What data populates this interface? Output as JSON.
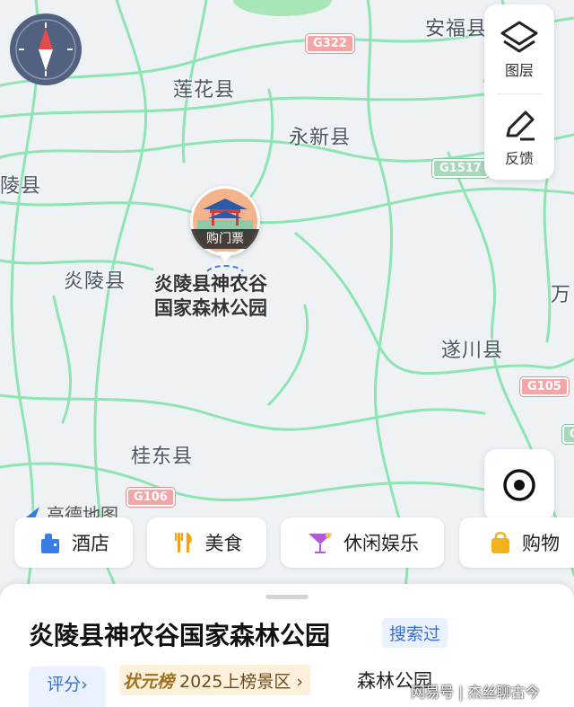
{
  "map": {
    "places": [
      {
        "name": "安福县"
      },
      {
        "name": "莲花县"
      },
      {
        "name": "永新县"
      },
      {
        "name": "陵县"
      },
      {
        "name": "炎陵县"
      },
      {
        "name": "遂川县"
      },
      {
        "name": "桂东县"
      },
      {
        "name": "万"
      }
    ],
    "roads": [
      "G322",
      "G1517",
      "G105",
      "G106",
      "G"
    ],
    "poi": {
      "ticket_label": "购门票",
      "name_line1": "炎陵县神农谷",
      "name_line2": "国家森林公园"
    },
    "watermark": "高德地图",
    "colors": {
      "road": "#7ee0a6",
      "bg": "#eef2f5",
      "compass": "#526180"
    }
  },
  "side_panel": {
    "layers_label": "图层",
    "feedback_label": "反馈",
    "layers_icon": "layers-icon",
    "feedback_icon": "pen-icon"
  },
  "categories": [
    {
      "label": "酒店",
      "icon": "hotel-icon"
    },
    {
      "label": "美食",
      "icon": "food-icon"
    },
    {
      "label": "休闲娱乐",
      "icon": "cocktail-icon"
    },
    {
      "label": "购物",
      "icon": "shopping-bag-icon"
    }
  ],
  "detail": {
    "title": "炎陵县神农谷国家森林公园",
    "searched_badge": "搜索过",
    "rating_button": "评分›",
    "rank_badge": "状元榜",
    "rank_text": "2025上榜景区 ›",
    "type": "森林公园",
    "credit": "网易号 | 杰丝聊古今"
  }
}
